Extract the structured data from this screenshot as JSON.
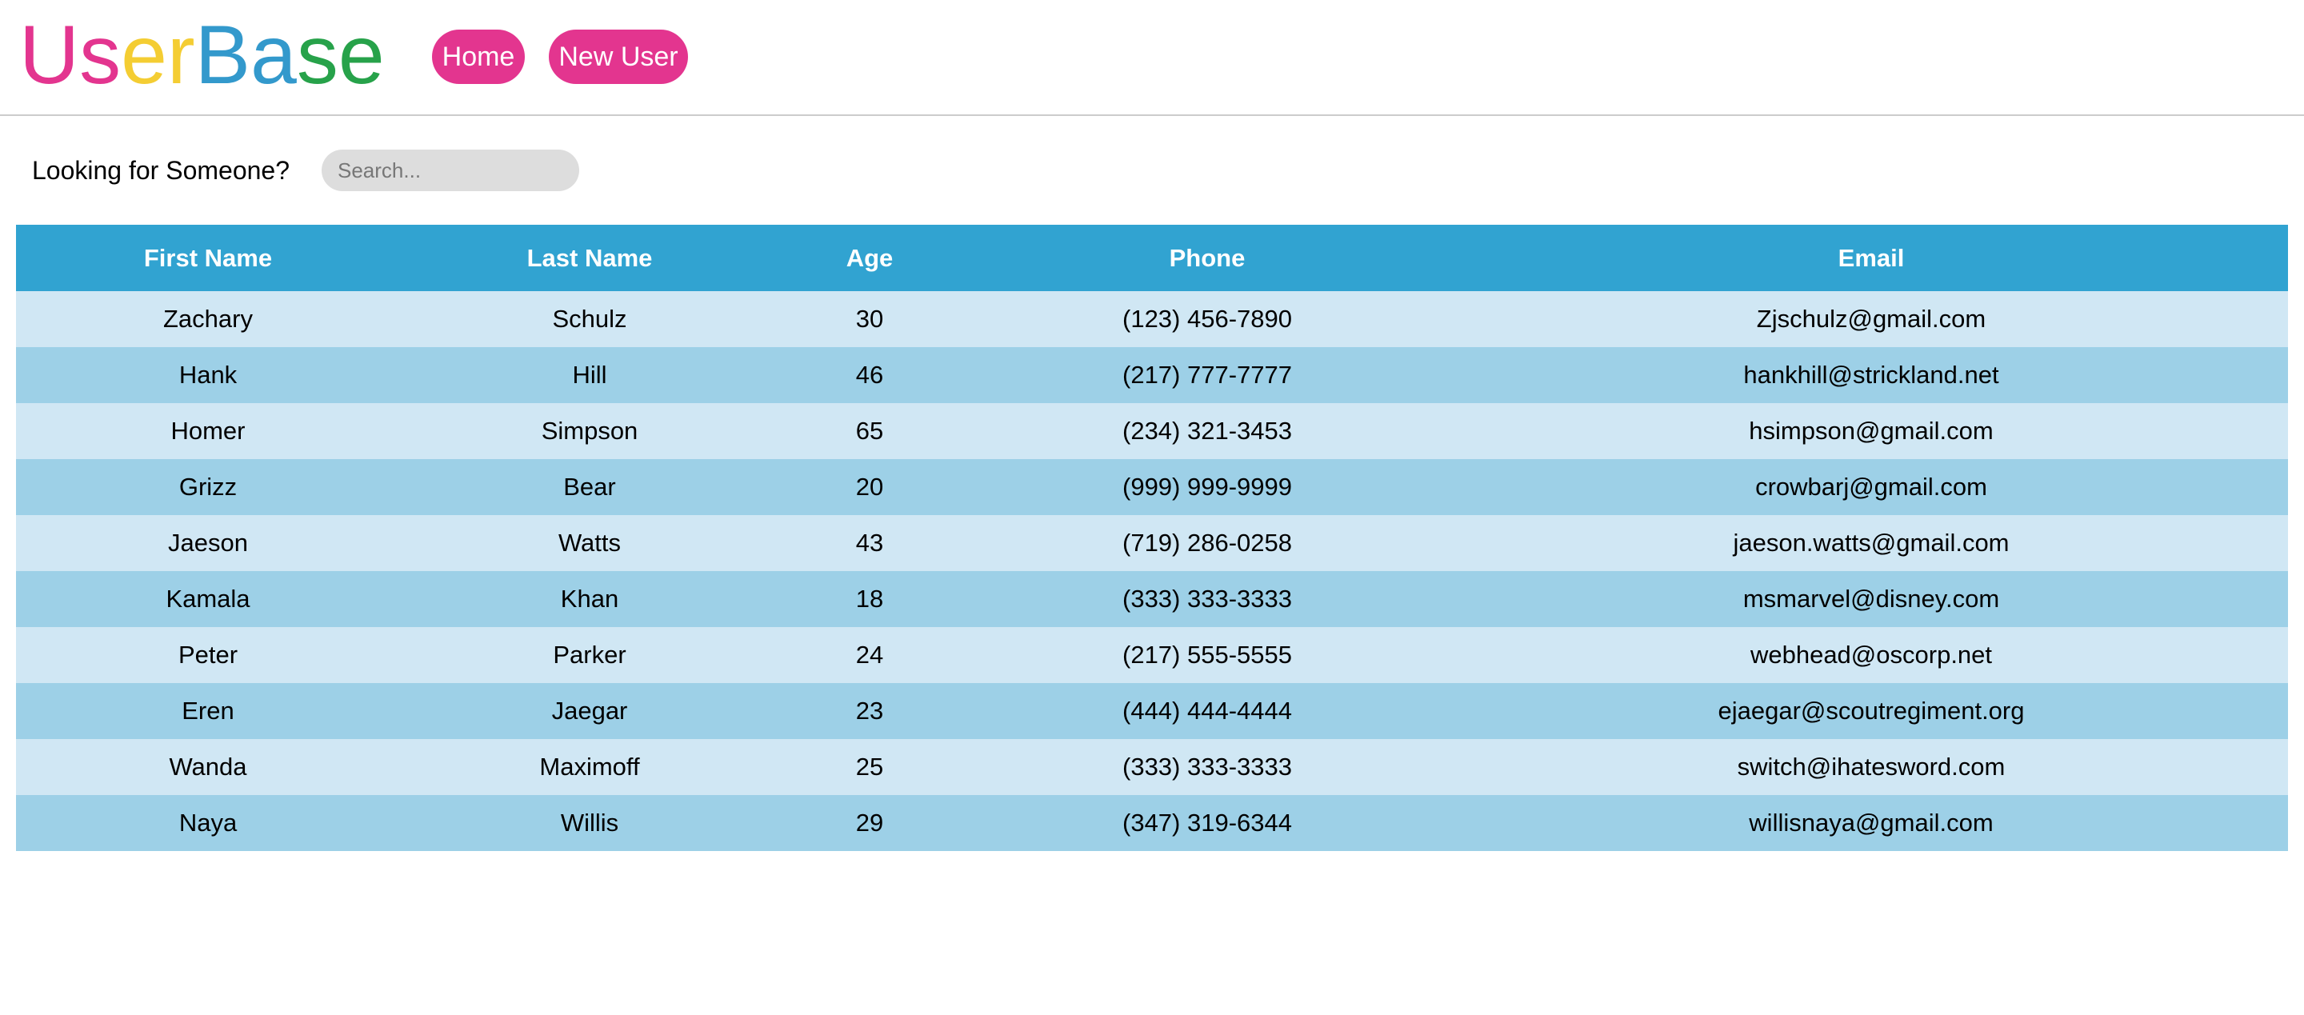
{
  "colors": {
    "brand_pink": "#e3358f",
    "brand_yellow": "#f4cd33",
    "brand_blue": "#3399cc",
    "brand_green": "#27a24a",
    "table_header": "#31a3d1",
    "row_light": "#d0e7f4",
    "row_dark": "#9dd0e7"
  },
  "logo": {
    "parts": [
      "Us",
      "er",
      "Ba",
      "se"
    ]
  },
  "nav": {
    "home_label": "Home",
    "new_user_label": "New User"
  },
  "search": {
    "label": "Looking for Someone?",
    "placeholder": "Search...",
    "value": ""
  },
  "table": {
    "columns": [
      "First Name",
      "Last Name",
      "Age",
      "Phone",
      "Email"
    ],
    "rows": [
      [
        "Zachary",
        "Schulz",
        "30",
        "(123) 456-7890",
        "Zjschulz@gmail.com"
      ],
      [
        "Hank",
        "Hill",
        "46",
        "(217) 777-7777",
        "hankhill@strickland.net"
      ],
      [
        "Homer",
        "Simpson",
        "65",
        "(234) 321-3453",
        "hsimpson@gmail.com"
      ],
      [
        "Grizz",
        "Bear",
        "20",
        "(999) 999-9999",
        "crowbarj@gmail.com"
      ],
      [
        "Jaeson",
        "Watts",
        "43",
        "(719) 286-0258",
        "jaeson.watts@gmail.com"
      ],
      [
        "Kamala",
        "Khan",
        "18",
        "(333) 333-3333",
        "msmarvel@disney.com"
      ],
      [
        "Peter",
        "Parker",
        "24",
        "(217) 555-5555",
        "webhead@oscorp.net"
      ],
      [
        "Eren",
        "Jaegar",
        "23",
        "(444) 444-4444",
        "ejaegar@scoutregiment.org"
      ],
      [
        "Wanda",
        "Maximoff",
        "25",
        "(333) 333-3333",
        "switch@ihatesword.com"
      ],
      [
        "Naya",
        "Willis",
        "29",
        "(347) 319-6344",
        "willisnaya@gmail.com"
      ]
    ]
  }
}
